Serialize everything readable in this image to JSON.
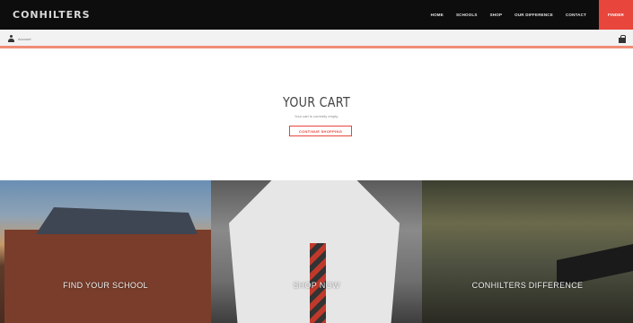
{
  "header": {
    "logo": "CONHILTERS",
    "nav": [
      "HOME",
      "SCHOOLS",
      "SHOP",
      "OUR DIFFERENCE",
      "CONTACT"
    ],
    "cta": "FINDER"
  },
  "subbar": {
    "account_label": "Account",
    "account_icon": "user-icon",
    "cart_icon": "bag-icon"
  },
  "cart": {
    "title": "YOUR CART",
    "message": "Your cart is currently empty.",
    "continue_label": "CONTINUE SHOPPING"
  },
  "tiles": [
    {
      "label": "FIND YOUR SCHOOL"
    },
    {
      "label": "SHOP NOW"
    },
    {
      "label": "CONHILTERS DIFFERENCE"
    }
  ],
  "colors": {
    "accent": "#e8453c",
    "header_bg": "#0d0d0d",
    "subbar_border": "#f08c77"
  }
}
